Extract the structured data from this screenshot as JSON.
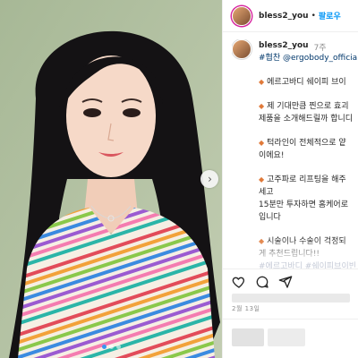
{
  "header": {
    "username": "bless2_you",
    "separator": "•",
    "follow_label": "팔로우"
  },
  "caption": {
    "username": "bless2_you",
    "time": "7주",
    "lines": [
      "#협찬 @ergobody_official",
      "",
      "에르고바디 쉐이피 브이",
      "",
      "제 기대만큼 찐으로 효괴",
      "제품을 소개해드릴까 합니디",
      "",
      "턱라인이 전체적으로 얕",
      "이에요!",
      "",
      "고주파로 리프팅을 해주",
      "세고",
      "15분만 투자하면 홈케어로",
      "입니다",
      "",
      "시술이나 수술이 걱정되",
      "게 추천드립니다!!",
      "",
      "#에르고바디 #쉐이피브이빈"
    ],
    "bullet_lines": [
      2,
      4,
      7,
      10,
      15
    ],
    "faded_line": "#에르고바디 #쉐이피브이빈"
  },
  "meta": {
    "date": "2월 13일"
  },
  "icons": {
    "heart": "heart-icon",
    "comment": "comment-icon",
    "share": "share-icon",
    "next": "chevron-right-icon"
  },
  "colors": {
    "link": "#0095f6",
    "hashtag": "#00376b",
    "bullet": "#e07a3a",
    "carousel_active_dot": "#3897f0"
  }
}
